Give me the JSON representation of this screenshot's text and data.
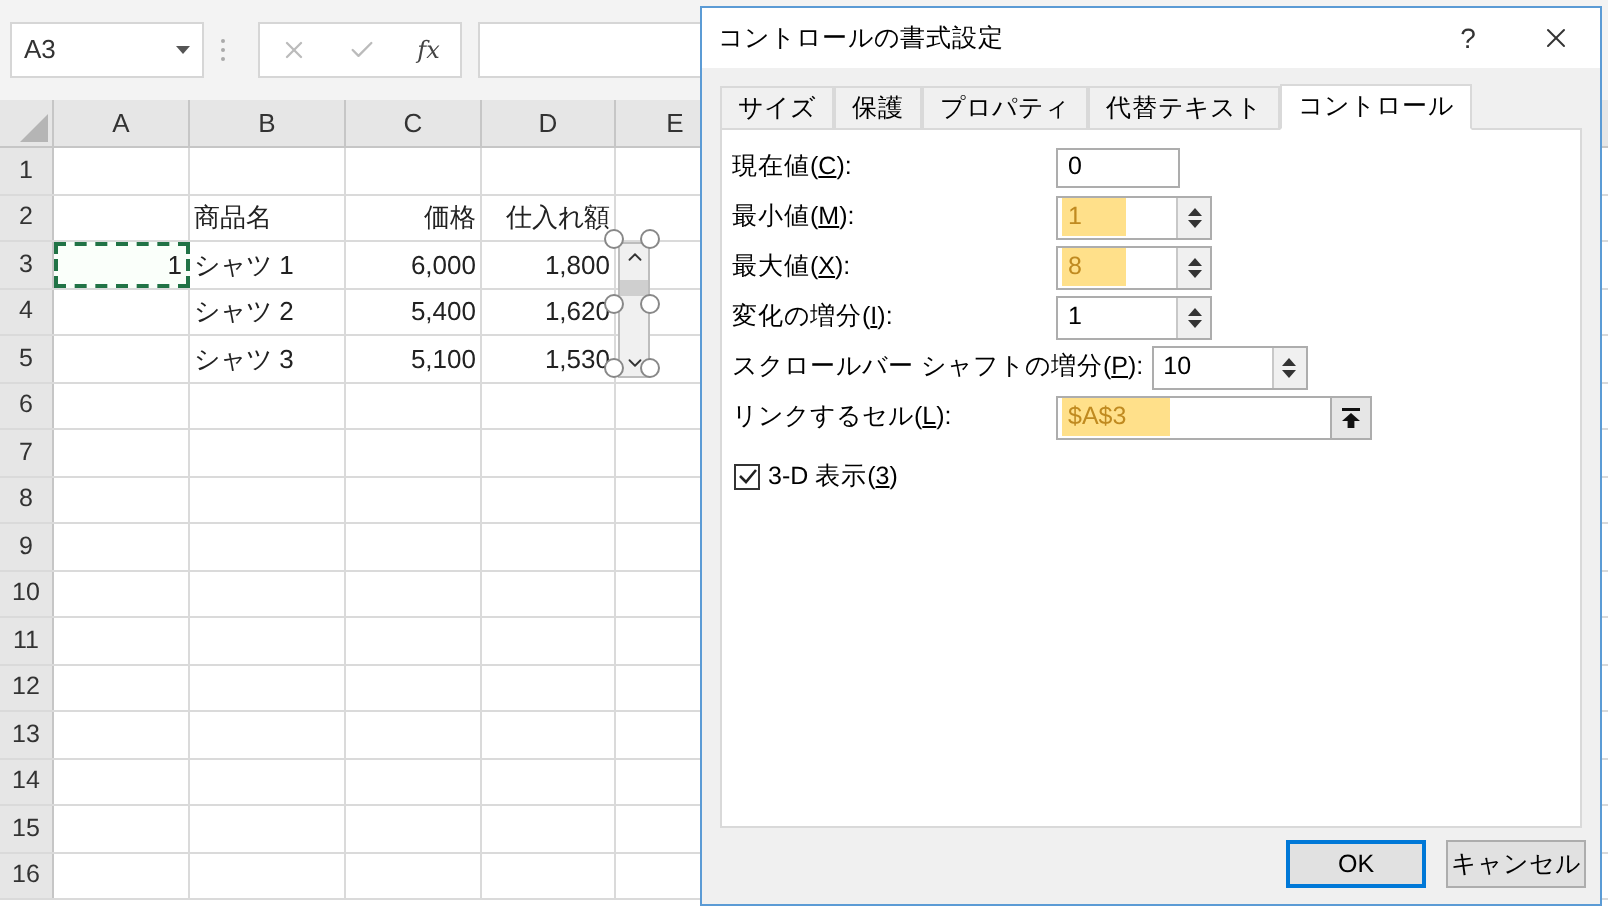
{
  "name_box": {
    "value": "A3"
  },
  "formula_bar": {
    "fx_label": "fx"
  },
  "sheet": {
    "columns": [
      "A",
      "B",
      "C",
      "D",
      "E"
    ],
    "rows": [
      {
        "number": "1"
      },
      {
        "number": "2",
        "cells": [
          {
            "selected": false
          },
          {
            "text": "商品名",
            "selected": false
          },
          {
            "text": "価格",
            "selected": false
          },
          {
            "text": "仕入れ額",
            "selected": false
          },
          {
            "selected": false
          }
        ]
      },
      {
        "number": "3",
        "cells": [
          {
            "text": "1",
            "selected": true
          },
          {
            "text": "シャツ 1",
            "selected": false
          },
          {
            "text": "6,000",
            "selected": false
          },
          {
            "text": "1,800",
            "selected": false
          },
          {
            "selected": false
          }
        ]
      },
      {
        "number": "4",
        "cells": [
          {
            "selected": false
          },
          {
            "text": "シャツ 2",
            "selected": false
          },
          {
            "text": "5,400",
            "selected": false
          },
          {
            "text": "1,620",
            "selected": false
          },
          {
            "selected": false
          }
        ]
      },
      {
        "number": "5",
        "cells": [
          {
            "selected": false
          },
          {
            "text": "シャツ 3",
            "selected": false
          },
          {
            "text": "5,100",
            "selected": false
          },
          {
            "text": "1,530",
            "selected": false
          },
          {
            "selected": false
          }
        ]
      },
      {
        "number": "6"
      },
      {
        "number": "7"
      },
      {
        "number": "8"
      },
      {
        "number": "9"
      },
      {
        "number": "10"
      },
      {
        "number": "11"
      },
      {
        "number": "12"
      },
      {
        "number": "13"
      },
      {
        "number": "14"
      },
      {
        "number": "15"
      },
      {
        "number": "16"
      }
    ]
  },
  "dialog": {
    "title": "コントロールの書式設定",
    "help": "?",
    "tabs": [
      {
        "label": "サイズ",
        "selected": false
      },
      {
        "label": "保護",
        "selected": false
      },
      {
        "label": "プロパティ",
        "selected": false
      },
      {
        "label": "代替テキスト",
        "selected": false
      },
      {
        "label": "コントロール",
        "selected": true
      }
    ],
    "fields": [
      {
        "kind": "number",
        "label_before": "現在値(",
        "accelerator": "C",
        "label_after": "):",
        "value": "0",
        "highlighted": false
      },
      {
        "kind": "spin",
        "label_before": "最小値(",
        "accelerator": "M",
        "label_after": "):",
        "value": "1",
        "highlighted": true
      },
      {
        "kind": "spin",
        "label_before": "最大値(",
        "accelerator": "X",
        "label_after": "):",
        "value": "8",
        "highlighted": true
      },
      {
        "kind": "spin",
        "label_before": "変化の増分(",
        "accelerator": "I",
        "label_after": "):",
        "value": "1",
        "highlighted": false
      },
      {
        "kind": "spin",
        "label_before": "スクロールバー シャフトの増分(",
        "accelerator": "P",
        "label_after": "):",
        "value": "10",
        "highlighted": false
      },
      {
        "kind": "ref",
        "label_before": "リンクするセル(",
        "accelerator": "L",
        "label_after": "):",
        "value": "$A$3",
        "highlighted": true
      }
    ],
    "checkbox": {
      "label_before": "3-D 表示(",
      "accelerator": "3",
      "label_after": ")",
      "checked": true
    },
    "buttons": [
      {
        "label": "OK",
        "default": true
      },
      {
        "label": "キャンセル",
        "default": false
      }
    ]
  }
}
